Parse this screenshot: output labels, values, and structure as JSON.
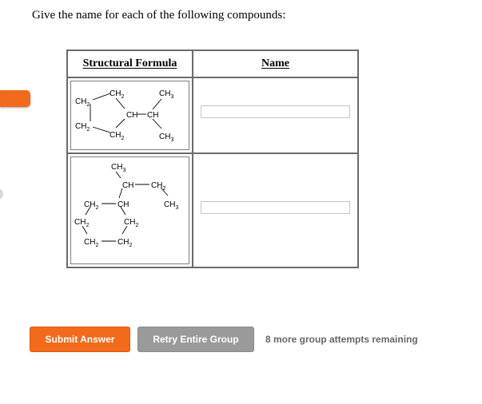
{
  "question": "Give the name for each of the following compounds:",
  "table": {
    "header_formula": "Structural Formula",
    "header_name": "Name",
    "rows": [
      {
        "labels": [
          "CH2",
          "CH2",
          "CH3",
          "CH",
          "CH",
          "CH2",
          "CH2",
          "CH3"
        ],
        "name_value": ""
      },
      {
        "labels": [
          "CH3",
          "CH",
          "CH2",
          "CH2",
          "CH",
          "CH3",
          "CH2",
          "CH2",
          "CH2",
          "CH2"
        ],
        "name_value": ""
      }
    ]
  },
  "buttons": {
    "submit": "Submit Answer",
    "retry": "Retry Entire Group"
  },
  "attempts_text": "8 more group attempts remaining",
  "colors": {
    "accent": "#f26a1b",
    "retry": "#9a9a9a",
    "border": "#6b6b6b"
  }
}
